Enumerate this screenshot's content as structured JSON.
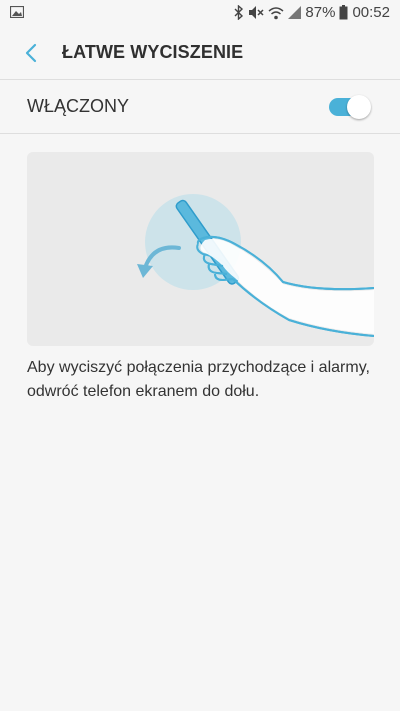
{
  "status_bar": {
    "battery_percent": "87%",
    "time": "00:52",
    "icons": [
      "image-icon",
      "bluetooth-icon",
      "mute-icon",
      "wifi-icon",
      "signal-icon",
      "battery-icon"
    ]
  },
  "header": {
    "title": "ŁATWE WYCISZENIE",
    "back_icon": "chevron-left-icon"
  },
  "master_switch": {
    "label": "WŁĄCZONY",
    "on": true,
    "accent_color": "#4ab1d8"
  },
  "illustration": {
    "icon": "flip-phone-gesture-illustration"
  },
  "description": "Aby wyciszyć połączenia przychodzące i alarmy, odwróć telefon ekranem do dołu."
}
